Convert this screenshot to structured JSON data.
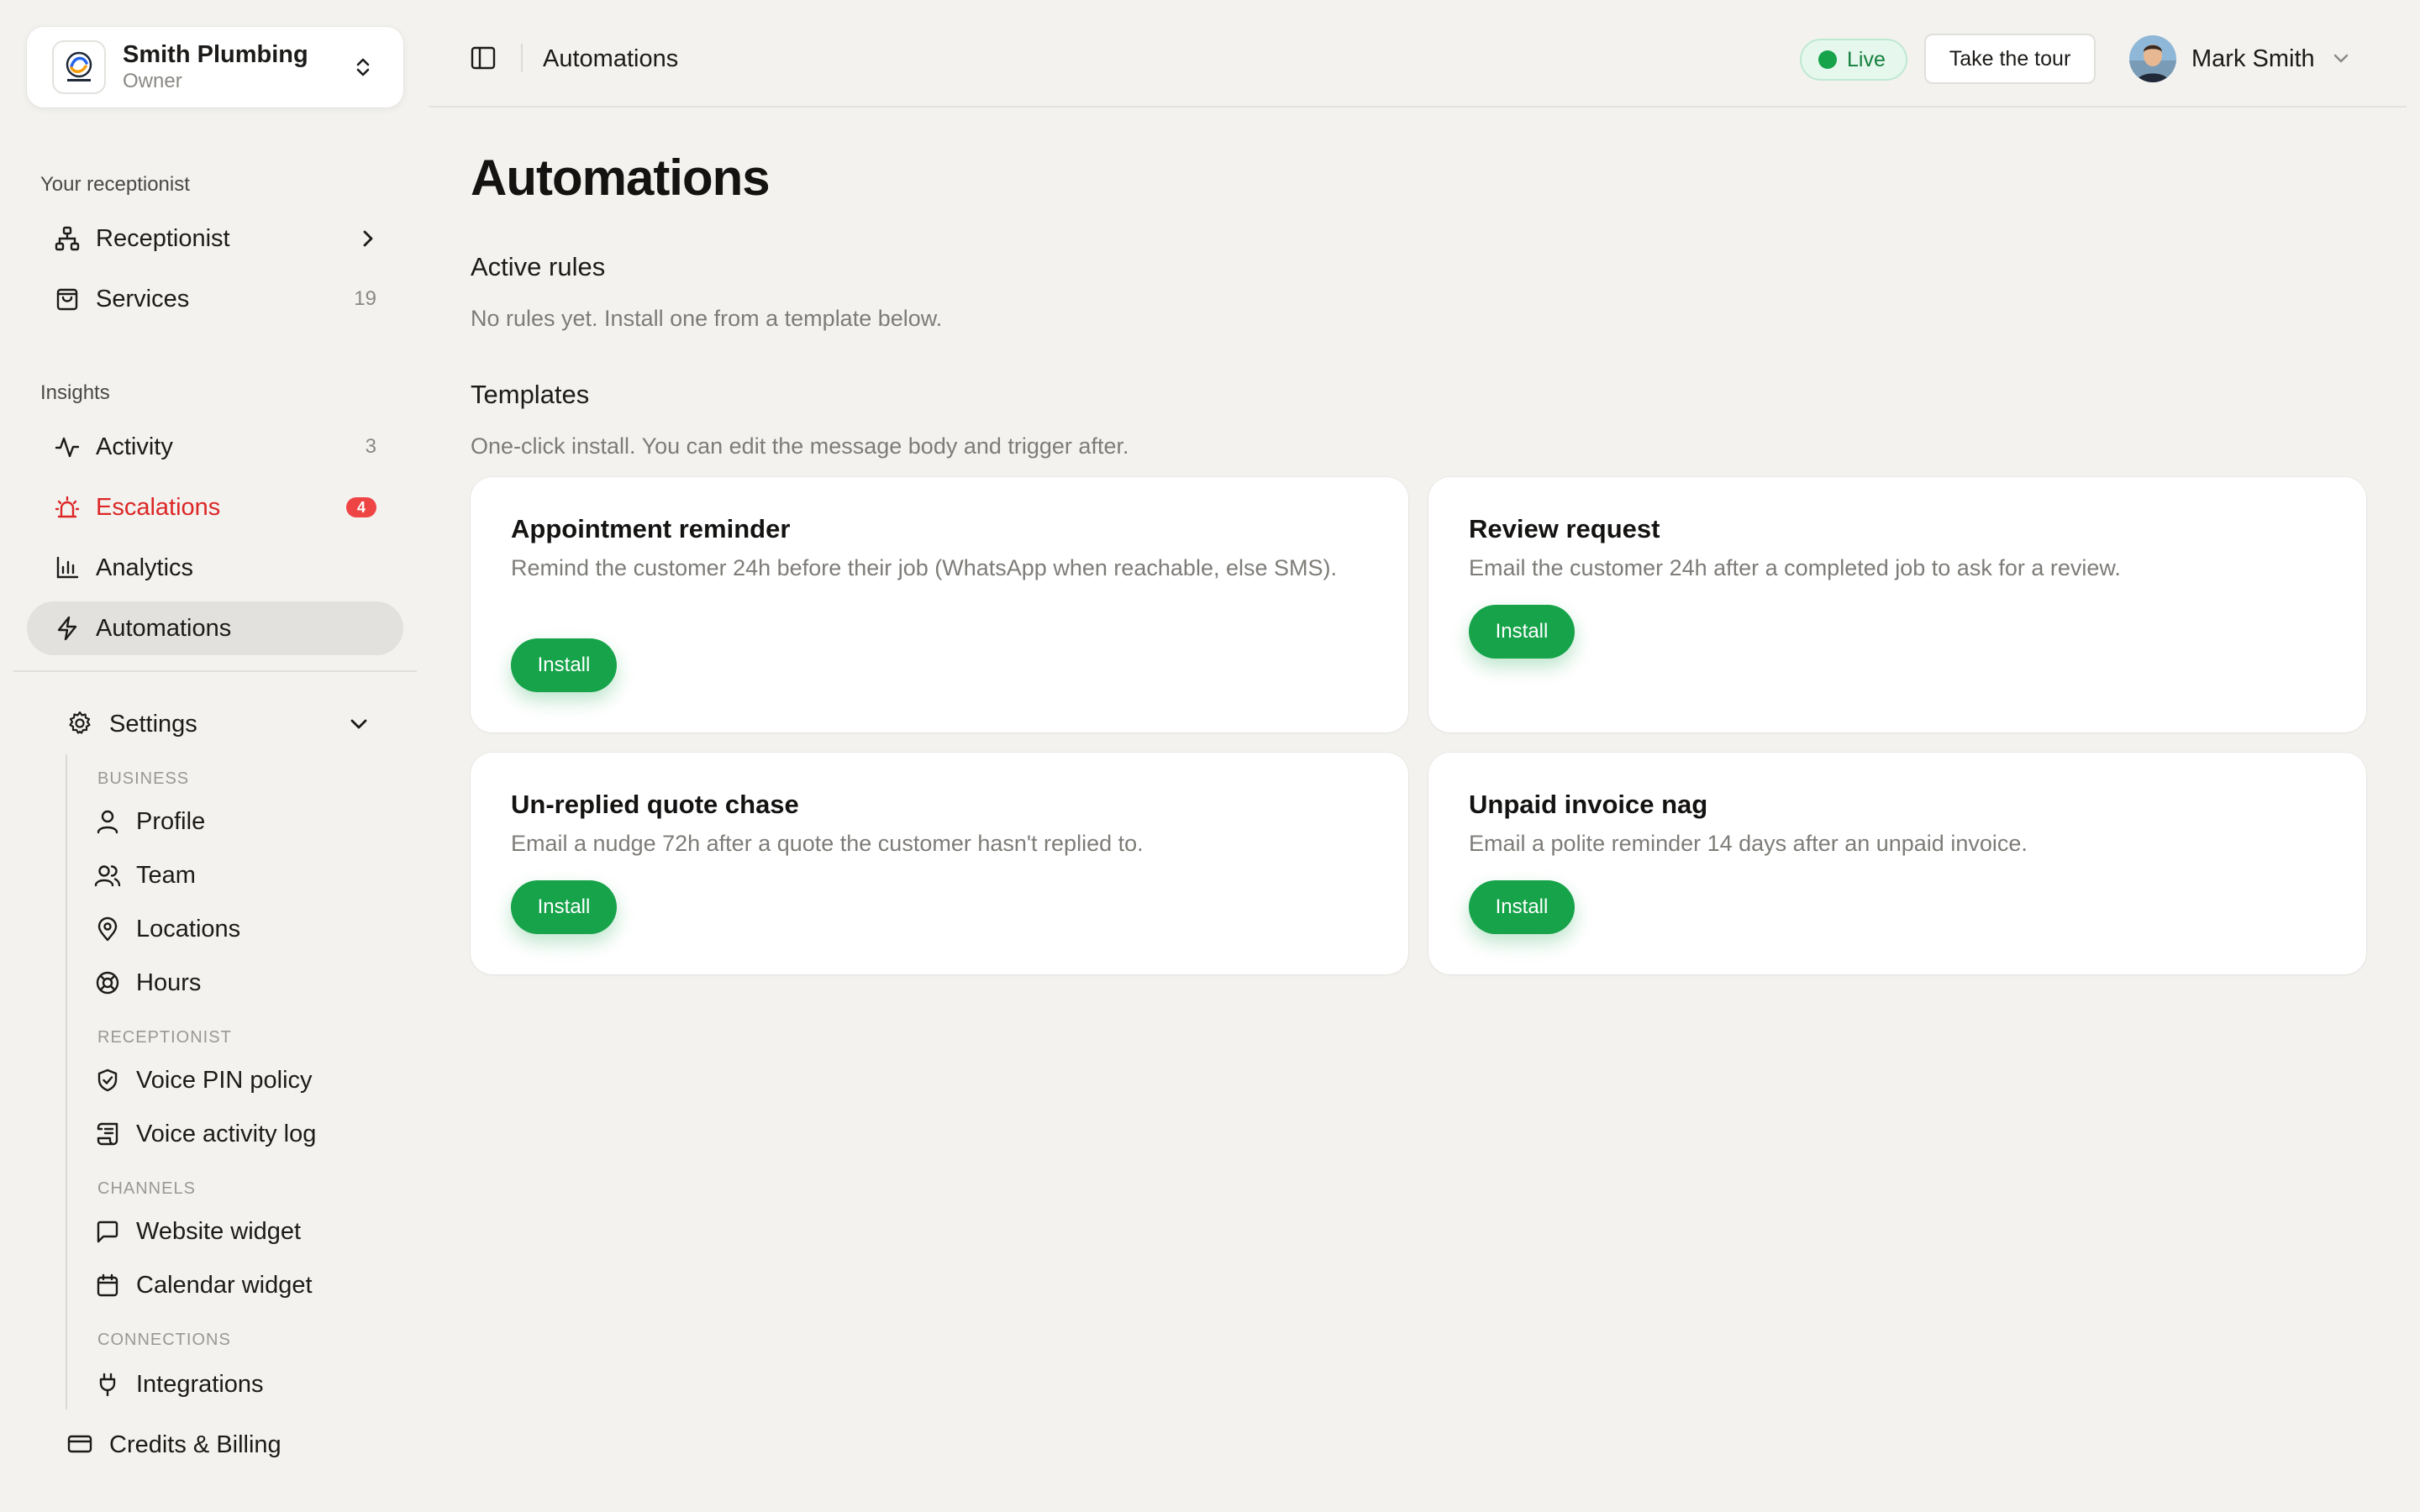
{
  "org": {
    "name": "Smith Plumbing",
    "role": "Owner"
  },
  "sidebar": {
    "section_receptionist": "Your receptionist",
    "section_insights": "Insights",
    "items": {
      "receptionist": {
        "label": "Receptionist"
      },
      "services": {
        "label": "Services",
        "count": "19"
      },
      "activity": {
        "label": "Activity",
        "count": "3"
      },
      "escalations": {
        "label": "Escalations",
        "badge": "4"
      },
      "analytics": {
        "label": "Analytics"
      },
      "automations": {
        "label": "Automations"
      }
    },
    "settings": {
      "label": "Settings",
      "groups": {
        "business": "BUSINESS",
        "receptionist": "RECEPTIONIST",
        "channels": "CHANNELS",
        "connections": "CONNECTIONS"
      },
      "items": {
        "profile": "Profile",
        "team": "Team",
        "locations": "Locations",
        "hours": "Hours",
        "voice_pin": "Voice PIN policy",
        "voice_log": "Voice activity log",
        "website_widget": "Website widget",
        "calendar_widget": "Calendar widget",
        "integrations": "Integrations"
      }
    },
    "billing": "Credits & Billing"
  },
  "topbar": {
    "title": "Automations",
    "live": "Live",
    "tour": "Take the tour",
    "user": "Mark Smith"
  },
  "main": {
    "title": "Automations",
    "active_rules": {
      "heading": "Active rules",
      "empty": "No rules yet. Install one from a template below."
    },
    "templates": {
      "heading": "Templates",
      "subtitle": "One-click install. You can edit the message body and trigger after.",
      "cards": [
        {
          "title": "Appointment reminder",
          "desc": "Remind the customer 24h before their job (WhatsApp when reachable, else SMS).",
          "button": "Install"
        },
        {
          "title": "Review request",
          "desc": "Email the customer 24h after a completed job to ask for a review.",
          "button": "Install"
        },
        {
          "title": "Un-replied quote chase",
          "desc": "Email a nudge 72h after a quote the customer hasn't replied to.",
          "button": "Install"
        },
        {
          "title": "Unpaid invoice nag",
          "desc": "Email a polite reminder 14 days after an unpaid invoice.",
          "button": "Install"
        }
      ]
    }
  },
  "colors": {
    "accent_green": "#16a34a",
    "danger_red": "#dc2626",
    "background": "#f3f2ef",
    "active_nav": "#e3e1dd"
  }
}
